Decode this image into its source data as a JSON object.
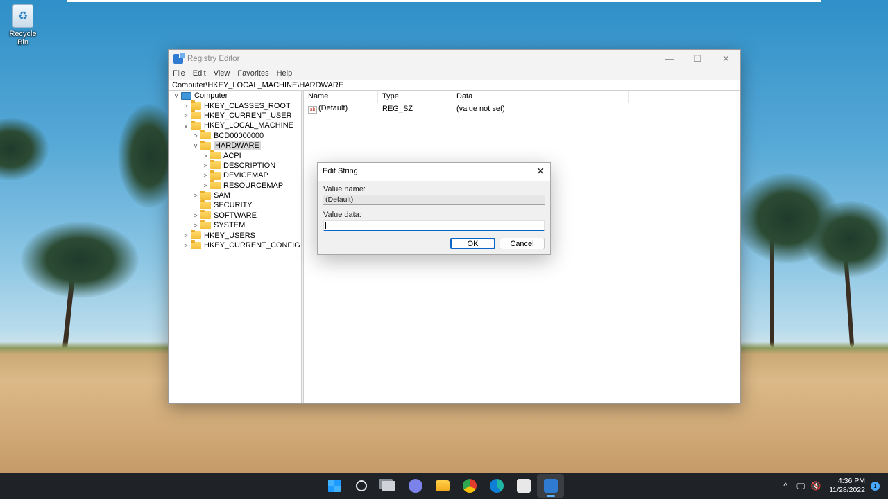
{
  "desktop": {
    "icons": [
      {
        "label": "Recycle Bin",
        "icon": "recycle-bin-icon"
      }
    ]
  },
  "regedit": {
    "title": "Registry Editor",
    "window_controls": {
      "minimize": "—",
      "maximize": "☐",
      "close": "✕"
    },
    "menu": [
      "File",
      "Edit",
      "View",
      "Favorites",
      "Help"
    ],
    "address": "Computer\\HKEY_LOCAL_MACHINE\\HARDWARE",
    "tree": [
      {
        "label": "Computer",
        "expanded": true
      },
      {
        "label": "HKEY_CLASSES_ROOT",
        "expanded": false
      },
      {
        "label": "HKEY_CURRENT_USER",
        "expanded": false
      },
      {
        "label": "HKEY_LOCAL_MACHINE",
        "expanded": true
      },
      {
        "label": "BCD00000000",
        "expanded": false
      },
      {
        "label": "HARDWARE",
        "expanded": true,
        "selected": true
      },
      {
        "label": "ACPI",
        "expanded": false
      },
      {
        "label": "DESCRIPTION",
        "expanded": false
      },
      {
        "label": "DEVICEMAP",
        "expanded": false
      },
      {
        "label": "RESOURCEMAP",
        "expanded": false
      },
      {
        "label": "SAM",
        "expanded": false
      },
      {
        "label": "SECURITY",
        "expanded": false
      },
      {
        "label": "SOFTWARE",
        "expanded": false
      },
      {
        "label": "SYSTEM",
        "expanded": false
      },
      {
        "label": "HKEY_USERS",
        "expanded": false
      },
      {
        "label": "HKEY_CURRENT_CONFIG",
        "expanded": false
      }
    ],
    "columns": [
      "Name",
      "Type",
      "Data"
    ],
    "values": [
      {
        "name": "(Default)",
        "type": "REG_SZ",
        "data": "(value not set)",
        "icon": "string-value-icon"
      }
    ]
  },
  "dialog": {
    "title": "Edit String",
    "close": "✕",
    "value_name_label": "Value name:",
    "value_name": "(Default)",
    "value_data_label": "Value data:",
    "value_data": "",
    "ok_label": "OK",
    "cancel_label": "Cancel"
  },
  "taskbar": {
    "apps": [
      "start-icon",
      "search-icon",
      "task-view-icon",
      "chat-icon",
      "file-explorer-icon",
      "chrome-icon",
      "edge-icon",
      "store-icon",
      "registry-editor-icon"
    ],
    "tray": {
      "chevron": "^",
      "network": "🖵",
      "volume": "🔇"
    },
    "time": "4:36 PM",
    "date": "11/28/2022",
    "notification_count": "1"
  },
  "colors": {
    "accent": "#0a64c8",
    "taskbar": "#1f2226",
    "selection": "#d9d9d9"
  }
}
